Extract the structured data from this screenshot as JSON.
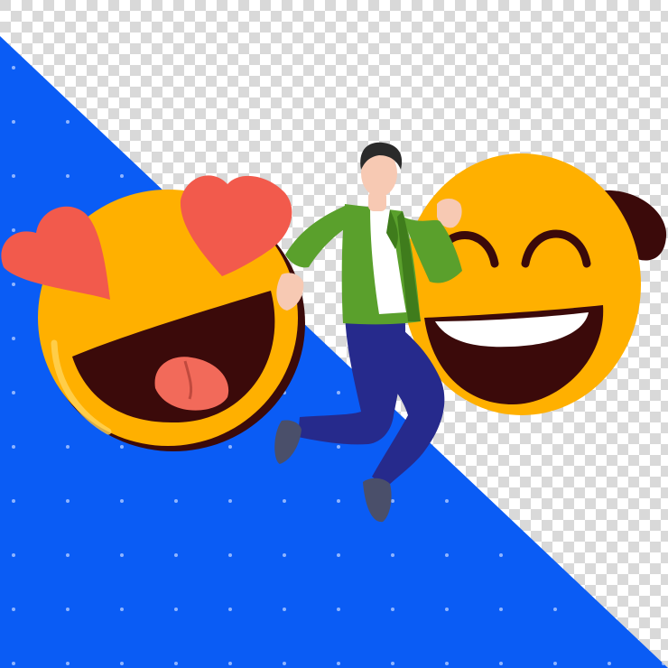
{
  "image": {
    "description_free": true,
    "background": {
      "checker_light": "#ffffff",
      "checker_dark": "#d9d9d9",
      "panel_color": "#0a5cf5",
      "dot_color": "#8fb4ff"
    },
    "emojis": [
      {
        "name": "heart-eyes-emoji",
        "icon": "heart-eyes-face-icon",
        "face_color": "#ffb000",
        "mouth_color": "#3b0a0a",
        "tongue_color": "#f26a5a",
        "heart_color": "#f25a4c"
      },
      {
        "name": "grinning-squint-emoji",
        "icon": "grinning-squinting-face-icon",
        "face_color": "#ffb000",
        "mouth_color": "#3b0a0a",
        "teeth_color": "#ffffff",
        "ear_color": "#3b0a0a"
      }
    ],
    "person": {
      "icon": "jumping-person-icon",
      "hair_color": "#2a2a2a",
      "skin_color": "#f7c9b3",
      "jacket_color": "#5aa02c",
      "jacket_shadow": "#3f7c1c",
      "shirt_color": "#ffffff",
      "pants_color": "#262a8c",
      "shoe_color": "#4a4f6a"
    }
  }
}
